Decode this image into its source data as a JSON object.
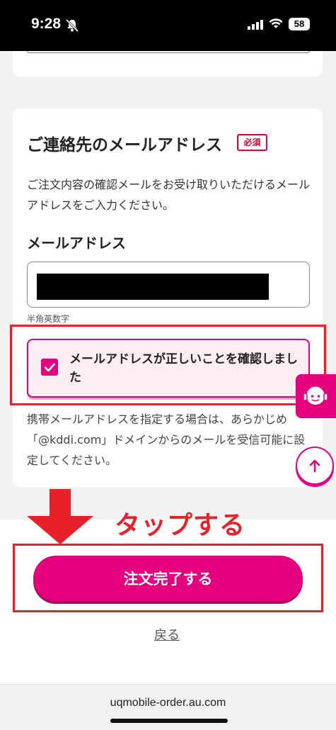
{
  "status_bar": {
    "time": "9:28",
    "battery": "58"
  },
  "email_section": {
    "title": "ご連絡先のメールアドレス",
    "required_badge": "必須",
    "description": "ご注文内容の確認メールをお受け取りいただけるメールアドレスをご入力ください。",
    "field_label": "メールアドレス",
    "field_hint": "半角英数字",
    "confirm_checkbox": {
      "label": "メールアドレスが正しいことを確認しました",
      "checked": true
    },
    "note": "携帯メールアドレスを指定する場合は、あらかじめ「@kddi.com」ドメインからのメールを受信可能に設定してください。"
  },
  "annotation": {
    "tap_label": "タップする"
  },
  "actions": {
    "complete_button": "注文完了する",
    "back_link": "戻る"
  },
  "browser": {
    "url": "uqmobile-order.au.com"
  },
  "colors": {
    "brand": "#e5007e",
    "annotation_red": "#e8202a"
  },
  "icons": [
    "bell-slash-icon",
    "signal-icon",
    "wifi-icon",
    "battery-icon",
    "check-icon",
    "support-operator-icon",
    "arrow-up-icon",
    "arrow-down-annotation-icon"
  ]
}
